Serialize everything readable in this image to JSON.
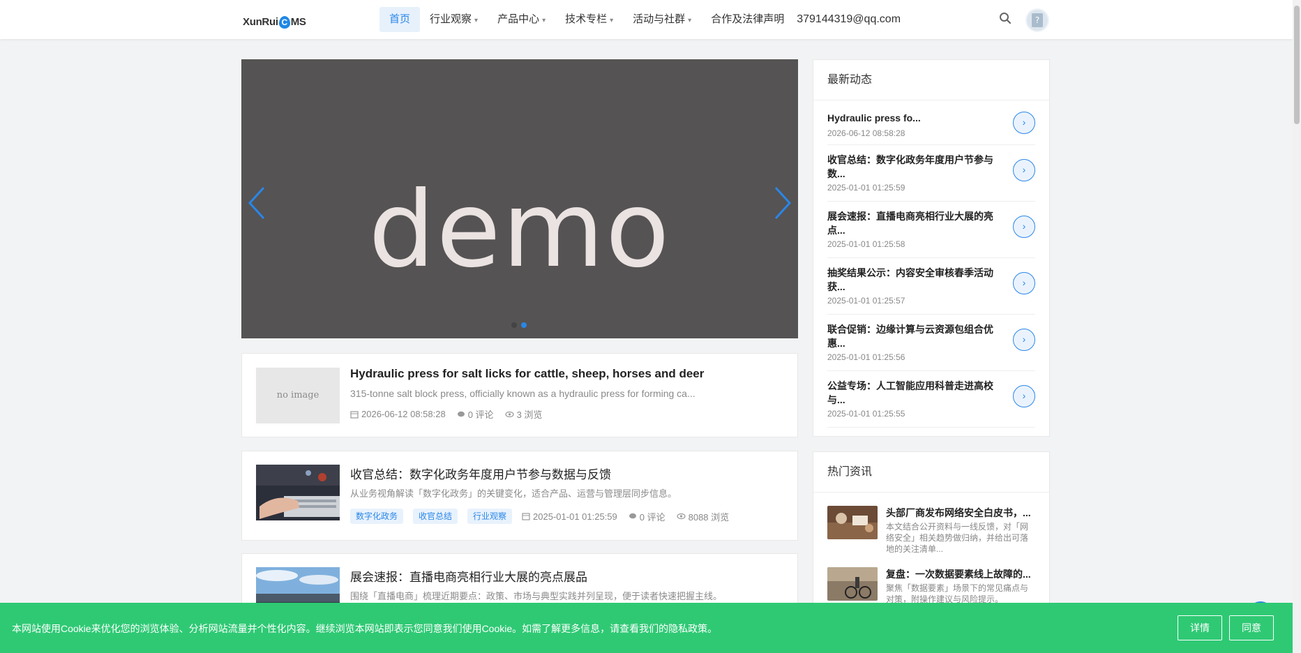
{
  "logo": {
    "pre": "XunRui",
    "c": "C",
    "post": "MS"
  },
  "nav": {
    "home": "首页",
    "industry": "行业观察",
    "products": "产品中心",
    "tech": "技术专栏",
    "events": "活动与社群",
    "legal": "合作及法律声明",
    "email": "379144319@qq.com",
    "caret": "▾"
  },
  "slider": {
    "text": "demo"
  },
  "articles": [
    {
      "title": "Hydraulic press for salt licks for cattle, sheep, horses and deer",
      "desc": "315-tonne salt block press, officially known as a hydraulic press for forming ca...",
      "thumb": "no image",
      "date": "2026-06-12 08:58:28",
      "comments": "0 评论",
      "views": "3 浏览"
    },
    {
      "title": "收官总结：数字化政务年度用户节参与数据与反馈",
      "desc": "从业务视角解读「数字化政务」的关键变化，适合产品、运营与管理层同步信息。",
      "tags": [
        "数字化政务",
        "收官总结",
        "行业观察"
      ],
      "date": "2025-01-01 01:25:59",
      "comments": "0 评论",
      "views": "8088 浏览"
    },
    {
      "title": "展会速报：直播电商亮相行业大展的亮点展品",
      "desc": "围绕「直播电商」梳理近期要点：政策、市场与典型实践并列呈现，便于读者快速把握主线。"
    }
  ],
  "latest": {
    "title": "最新动态",
    "go": "›",
    "items": [
      {
        "title": "Hydraulic press fo...",
        "date": "2026-06-12 08:58:28"
      },
      {
        "title": "收官总结：数字化政务年度用户节参与数...",
        "date": "2025-01-01 01:25:59"
      },
      {
        "title": "展会速报：直播电商亮相行业大展的亮点...",
        "date": "2025-01-01 01:25:58"
      },
      {
        "title": "抽奖结果公示：内容安全审核春季活动获...",
        "date": "2025-01-01 01:25:57"
      },
      {
        "title": "联合促销：边缘计算与云资源包组合优惠...",
        "date": "2025-01-01 01:25:56"
      },
      {
        "title": "公益专场：人工智能应用科普走进高校与...",
        "date": "2025-01-01 01:25:55"
      }
    ]
  },
  "hot": {
    "title": "热门资讯",
    "items": [
      {
        "title": "头部厂商发布网络安全白皮书，...",
        "desc": "本文结合公开资料与一线反馈，对「网络安全」相关趋势做归纳，并给出可落地的关注清单..."
      },
      {
        "title": "复盘：一次数据要素线上故障的...",
        "desc": "聚焦「数据要素」场景下的常见痛点与对策，附操作建议与风险提示。"
      }
    ]
  },
  "cookie": {
    "text": "本网站使用Cookie来优化您的浏览体验、分析网站流量并个性化内容。继续浏览本网站即表示您同意我们使用Cookie。如需了解更多信息，请查看我们的隐私政策。",
    "details": "详情",
    "agree": "同意"
  },
  "colors": {
    "accent": "#2a86e8",
    "cookie_bg": "#2fc974",
    "slider_bg": "#555353"
  }
}
